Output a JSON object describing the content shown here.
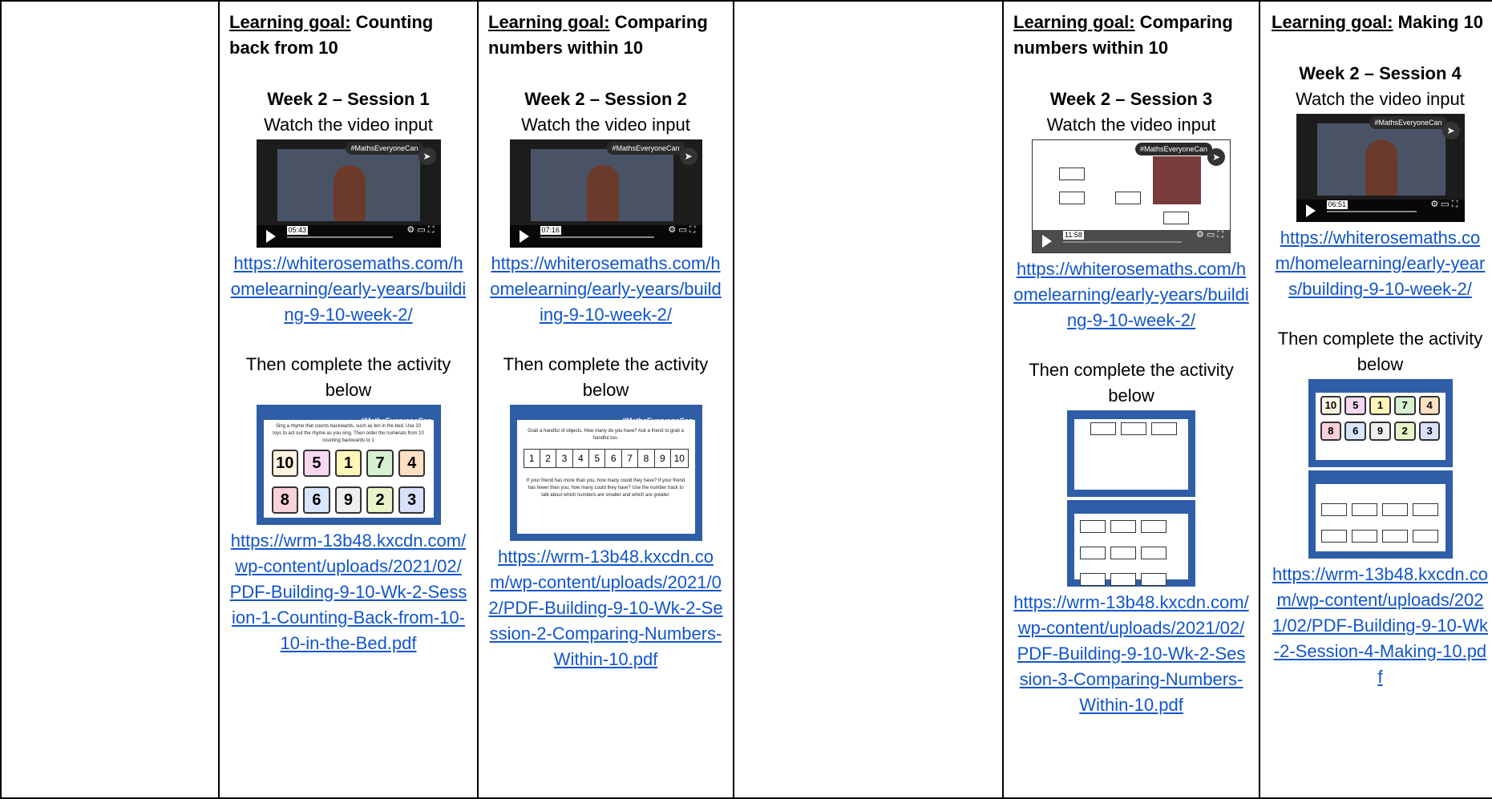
{
  "columns": [
    {
      "goal_label": "Learning goal:",
      "goal_text": " Counting back from 10",
      "week": "Week 2 – Session 1",
      "watch": "Watch the video input",
      "video_time": "05:43",
      "video_brand": "#MathsEveryoneCan",
      "video_link": "https://whiterosemaths.com/homelearning/early-years/building-9-10-week-2/",
      "then": "Then complete the activity below",
      "activity_link": "https://wrm-13b48.kxcdn.com/wp-content/uploads/2021/02/PDF-Building-9-10-Wk-2-Session-1-Counting-Back-from-10-10-in-the-Bed.pdf",
      "activity_heading": "Sing a rhyme that counts backwards, such as ten in the bed. Use 10 toys to act out the rhyme as you sing. Then order the numerals from 10 counting backwards to 1",
      "cards_top": [
        "10",
        "5",
        "1",
        "7",
        "4"
      ],
      "cards_bottom": [
        "8",
        "6",
        "9",
        "2",
        "3"
      ]
    },
    {
      "goal_label": "Learning goal:",
      "goal_text": " Comparing numbers within 10",
      "week": "Week 2 – Session 2",
      "watch": "Watch the video input",
      "video_time": "07:16",
      "video_brand": "#MathsEveryoneCan",
      "video_link": "https://whiterosemaths.com/homelearning/early-years/building-9-10-week-2/",
      "then": "Then complete the activity below",
      "activity_link": "https://wrm-13b48.kxcdn.com/wp-content/uploads/2021/02/PDF-Building-9-10-Wk-2-Session-2-Comparing-Numbers-Within-10.pdf",
      "activity_heading": "Grab a handful of objects. How many do you have? Ask a friend to grab a handful too.",
      "activity_footer": "If your friend has more than you, how many could they have? If your friend has fewer than you, how many could they have? Use the number track to talk about which numbers are smaller and which are greater.",
      "track": [
        "1",
        "2",
        "3",
        "4",
        "5",
        "6",
        "7",
        "8",
        "9",
        "10"
      ]
    },
    {
      "goal_label": "Learning goal:",
      "goal_text": " Comparing numbers within 10",
      "week": "Week 2 – Session 3",
      "watch": "Watch the video input",
      "video_time": "11:58",
      "video_brand": "#MathsEveryoneCan",
      "video_link": "https://whiterosemaths.com/homelearning/early-years/building-9-10-week-2/",
      "then": "Then complete the activity below",
      "activity_link": "https://wrm-13b48.kxcdn.com/wp-content/uploads/2021/02/PDF-Building-9-10-Wk-2-Session-3-Comparing-Numbers-Within-10.pdf"
    },
    {
      "goal_label": "Learning goal:",
      "goal_text": " Making 10",
      "week": "Week 2 – Session 4",
      "watch": "Watch the video input",
      "video_time": "06:51",
      "video_brand": "#MathsEveryoneCan",
      "video_link": "https://whiterosemaths.com/homelearning/early-years/building-9-10-week-2/",
      "then": "Then complete the activity below",
      "activity_link": "https://wrm-13b48.kxcdn.com/wp-content/uploads/2021/02/PDF-Building-9-10-Wk-2-Session-4-Making-10.pdf",
      "cards_top": [
        "10",
        "5",
        "1",
        "7",
        "4"
      ],
      "cards_bottom": [
        "8",
        "6",
        "9",
        "2",
        "3"
      ]
    }
  ],
  "colors": {
    "link": "#1155cc",
    "slide_border": "#2f5ea6"
  }
}
